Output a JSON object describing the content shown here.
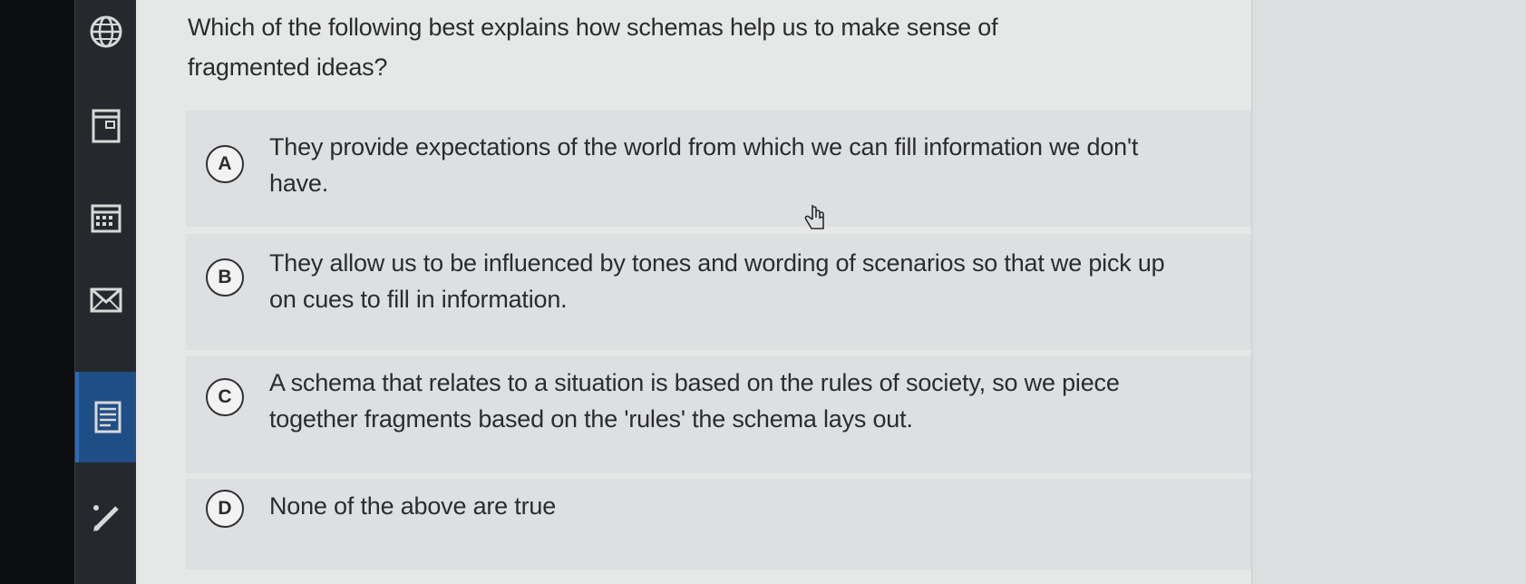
{
  "sidebar": {
    "icons": [
      "globe-icon",
      "panel-icon",
      "calendar-icon",
      "mail-icon",
      "document-icon",
      "pencil-icon"
    ],
    "active_index": 4
  },
  "question": {
    "text": "Which of the following best explains how schemas help us to make sense of fragmented ideas?"
  },
  "choices": [
    {
      "letter": "A",
      "text": "They provide expectations of the world from which we can fill information we don't have."
    },
    {
      "letter": "B",
      "text": "They allow us to be influenced by tones and wording of scenarios so that we pick up on cues to fill in information."
    },
    {
      "letter": "C",
      "text": "A schema that relates to a situation is based on the rules of society, so we piece together fragments based on the 'rules' the schema lays out."
    },
    {
      "letter": "D",
      "text": "None of the above are true"
    }
  ],
  "colors": {
    "sidebar_bg": "#25282c",
    "active_tab": "#1f4e86",
    "content_bg": "#e6e7e7",
    "choice_bg": "#dedfe0",
    "text": "#2b2c2e"
  }
}
